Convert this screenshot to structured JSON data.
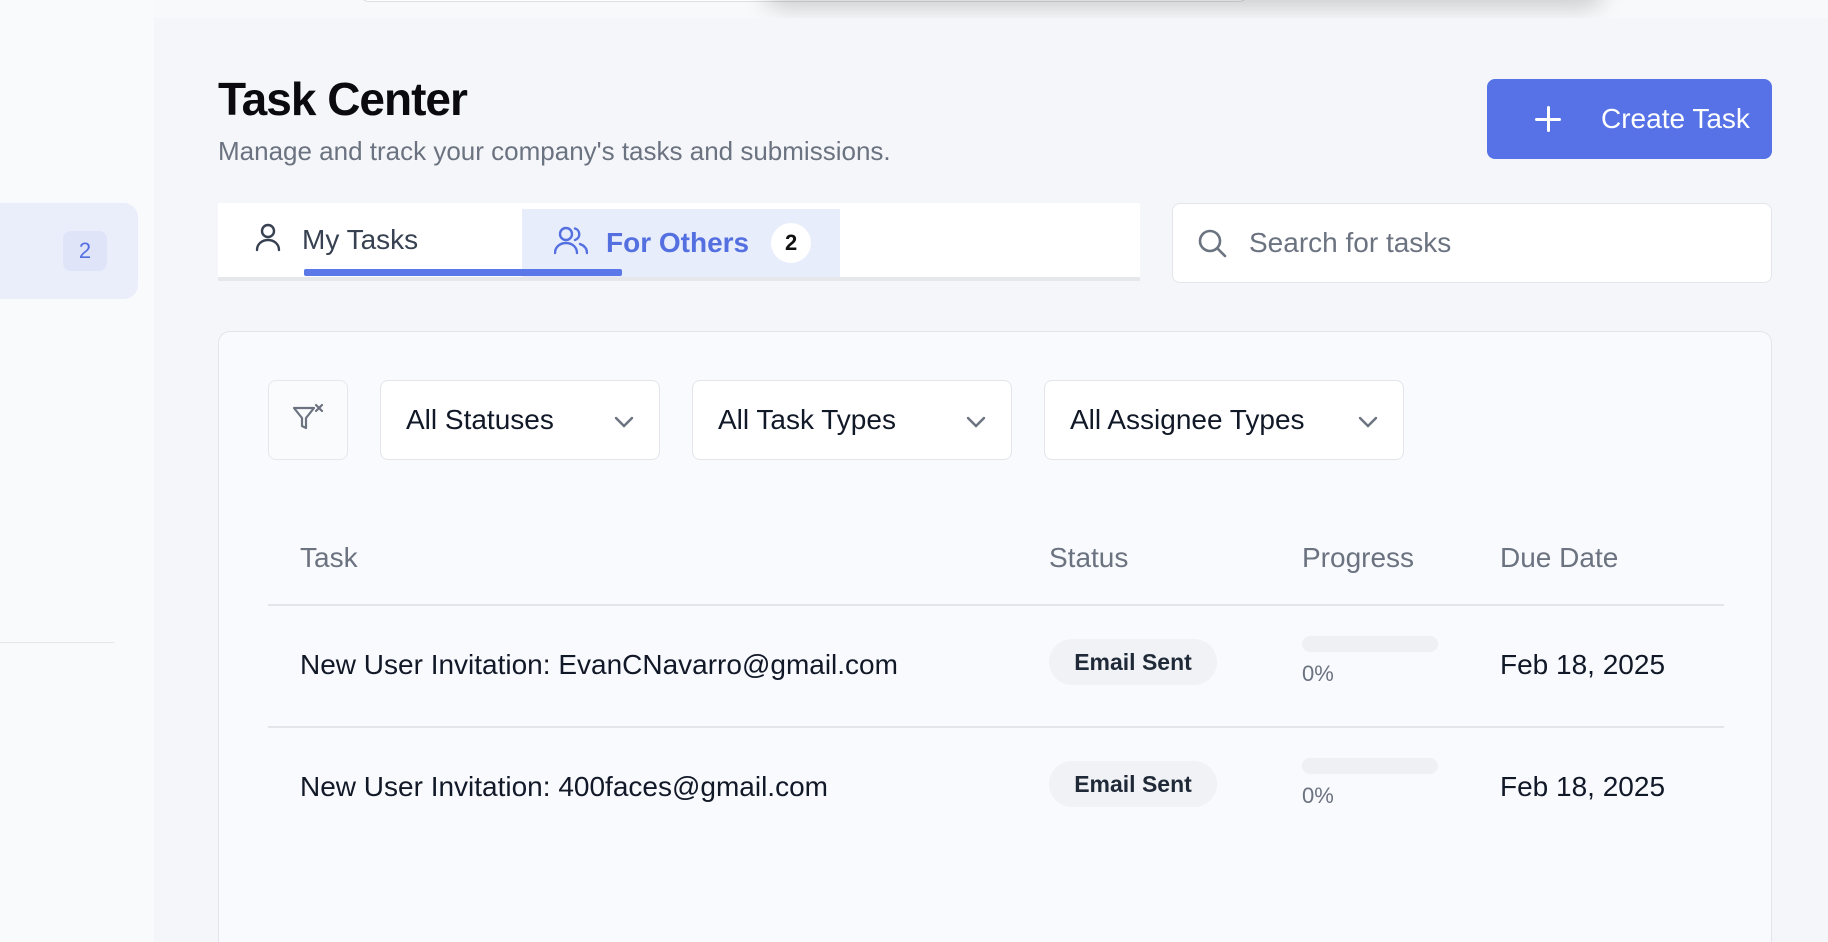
{
  "sidebar": {
    "active_badge": "2"
  },
  "header": {
    "title": "Task Center",
    "subtitle": "Manage and track your company's tasks and submissions.",
    "create_label": "Create Task"
  },
  "tabs": [
    {
      "label": "My Tasks",
      "icon": "user-icon"
    },
    {
      "label": "For Others",
      "icon": "users-icon",
      "count": "2"
    }
  ],
  "search": {
    "placeholder": "Search for tasks",
    "value": ""
  },
  "filters": {
    "status": "All Statuses",
    "task_type": "All Task Types",
    "assignee_type": "All Assignee Types"
  },
  "table": {
    "columns": [
      "Task",
      "Status",
      "Progress",
      "Due Date"
    ],
    "rows": [
      {
        "task": "New User Invitation: EvanCNavarro@gmail.com",
        "status": "Email Sent",
        "progress": 0,
        "progress_label": "0%",
        "due": "Feb 18, 2025"
      },
      {
        "task": "New User Invitation: 400faces@gmail.com",
        "status": "Email Sent",
        "progress": 0,
        "progress_label": "0%",
        "due": "Feb 18, 2025"
      }
    ]
  },
  "colors": {
    "accent": "#5672e6",
    "tab_active_bg": "#e8edfc"
  }
}
